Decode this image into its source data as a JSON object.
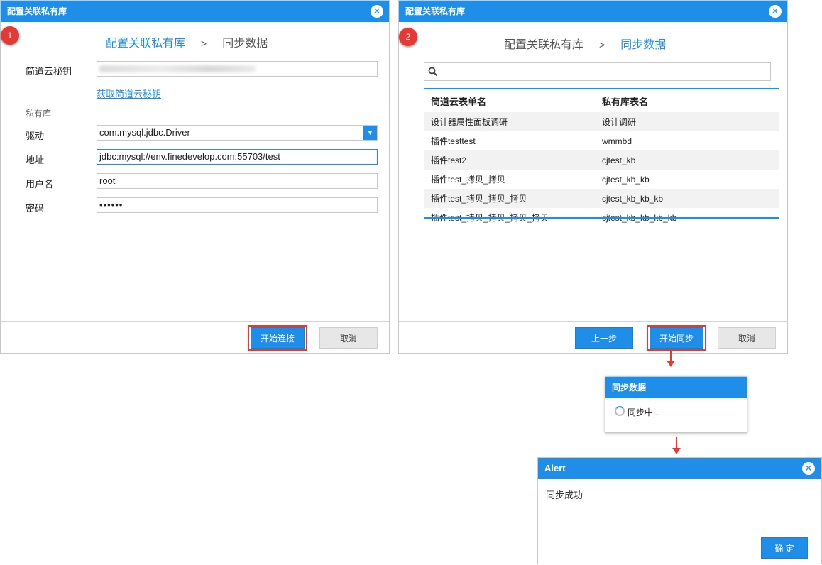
{
  "dialog1": {
    "title": "配置关联私有库",
    "close_glyph": "✕",
    "step_number": "1",
    "steps": [
      "配置关联私有库",
      "同步数据"
    ],
    "step_separator": ">",
    "secret_label": "简道云秘钥",
    "get_secret_link": "获取简道云秘钥",
    "section_label": "私有库",
    "driver_label": "驱动",
    "driver_value": "com.mysql.jdbc.Driver",
    "address_label": "地址",
    "address_value": "jdbc:mysql://env.finedevelop.com:55703/test",
    "username_label": "用户名",
    "username_value": "root",
    "password_label": "密码",
    "password_value": "••••••",
    "connect_button": "开始连接",
    "cancel_button": "取消"
  },
  "dialog2": {
    "title": "配置关联私有库",
    "close_glyph": "✕",
    "step_number": "2",
    "steps": [
      "配置关联私有库",
      "同步数据"
    ],
    "step_separator": ">",
    "columns": [
      "简道云表单名",
      "私有库表名"
    ],
    "rows": [
      [
        "设计器属性面板调研",
        "设计调研"
      ],
      [
        "插件testtest",
        "wmmbd"
      ],
      [
        "插件test2",
        "cjtest_kb"
      ],
      [
        "插件test_拷贝_拷贝",
        "cjtest_kb_kb"
      ],
      [
        "插件test_拷贝_拷贝_拷贝",
        "cjtest_kb_kb_kb"
      ],
      [
        "插件test_拷贝_拷贝_拷贝_拷贝",
        "cjtest_kb_kb_kb_kb"
      ]
    ],
    "prev_button": "上一步",
    "sync_button": "开始同步",
    "cancel_button": "取消"
  },
  "sync_popup": {
    "title": "同步数据",
    "status": "同步中..."
  },
  "alert": {
    "title": "Alert",
    "close_glyph": "✕",
    "message": "同步成功",
    "ok_button": "确 定"
  },
  "colors": {
    "accent": "#1f8ee8",
    "highlight": "#e53935"
  }
}
